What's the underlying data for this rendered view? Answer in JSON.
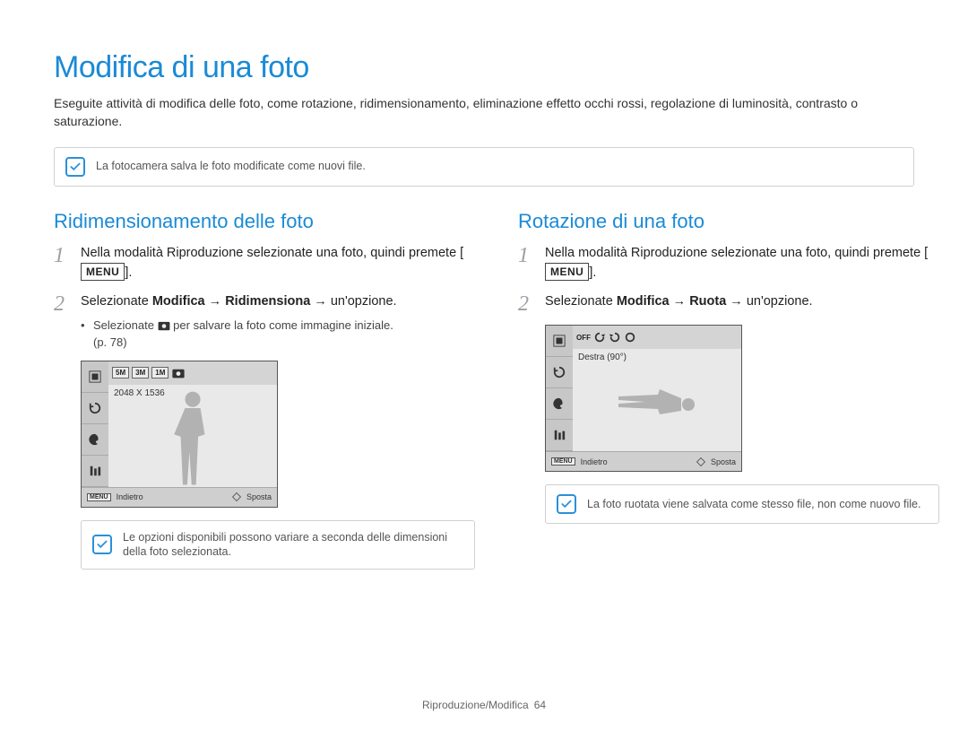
{
  "title": "Modifica di una foto",
  "intro": "Eseguite attività di modifica delle foto, come rotazione, ridimensionamento, eliminazione effetto occhi rossi, regolazione di luminosità, contrasto o saturazione.",
  "top_note": "La fotocamera salva le foto modificate come nuovi file.",
  "left": {
    "heading": "Ridimensionamento delle foto",
    "step1_a": "Nella modalità Riproduzione selezionate una foto, quindi premete [",
    "step1_menu": "MENU",
    "step1_b": "].",
    "step2_a": "Selezionate ",
    "step2_b": "Modifica",
    "step2_c": " → ",
    "step2_d": "Ridimensiona",
    "step2_e": " → un'opzione.",
    "bullet_a": "Selezionate ",
    "bullet_b": " per salvare la foto come immagine iniziale.",
    "page_ref": "(p. 78)",
    "cam": {
      "label": "2048 X 1536",
      "toprow": [
        "5M",
        "3M",
        "1M"
      ],
      "back_label": "Indietro",
      "move_label": "Sposta",
      "menu": "MENU"
    },
    "bottom_note": "Le opzioni disponibili possono variare a seconda delle dimensioni della foto selezionata."
  },
  "right": {
    "heading": "Rotazione di una foto",
    "step1_a": "Nella modalità Riproduzione selezionate una foto, quindi premete [",
    "step1_menu": "MENU",
    "step1_b": "].",
    "step2_a": "Selezionate ",
    "step2_b": "Modifica",
    "step2_c": " → ",
    "step2_d": "Ruota",
    "step2_e": " → un'opzione.",
    "cam": {
      "label": "Destra (90°)",
      "off_label": "OFF",
      "back_label": "Indietro",
      "move_label": "Sposta",
      "menu": "MENU"
    },
    "bottom_note": "La foto ruotata viene salvata come stesso file, non come nuovo file."
  },
  "footer_section": "Riproduzione/Modifica",
  "footer_page": "64"
}
